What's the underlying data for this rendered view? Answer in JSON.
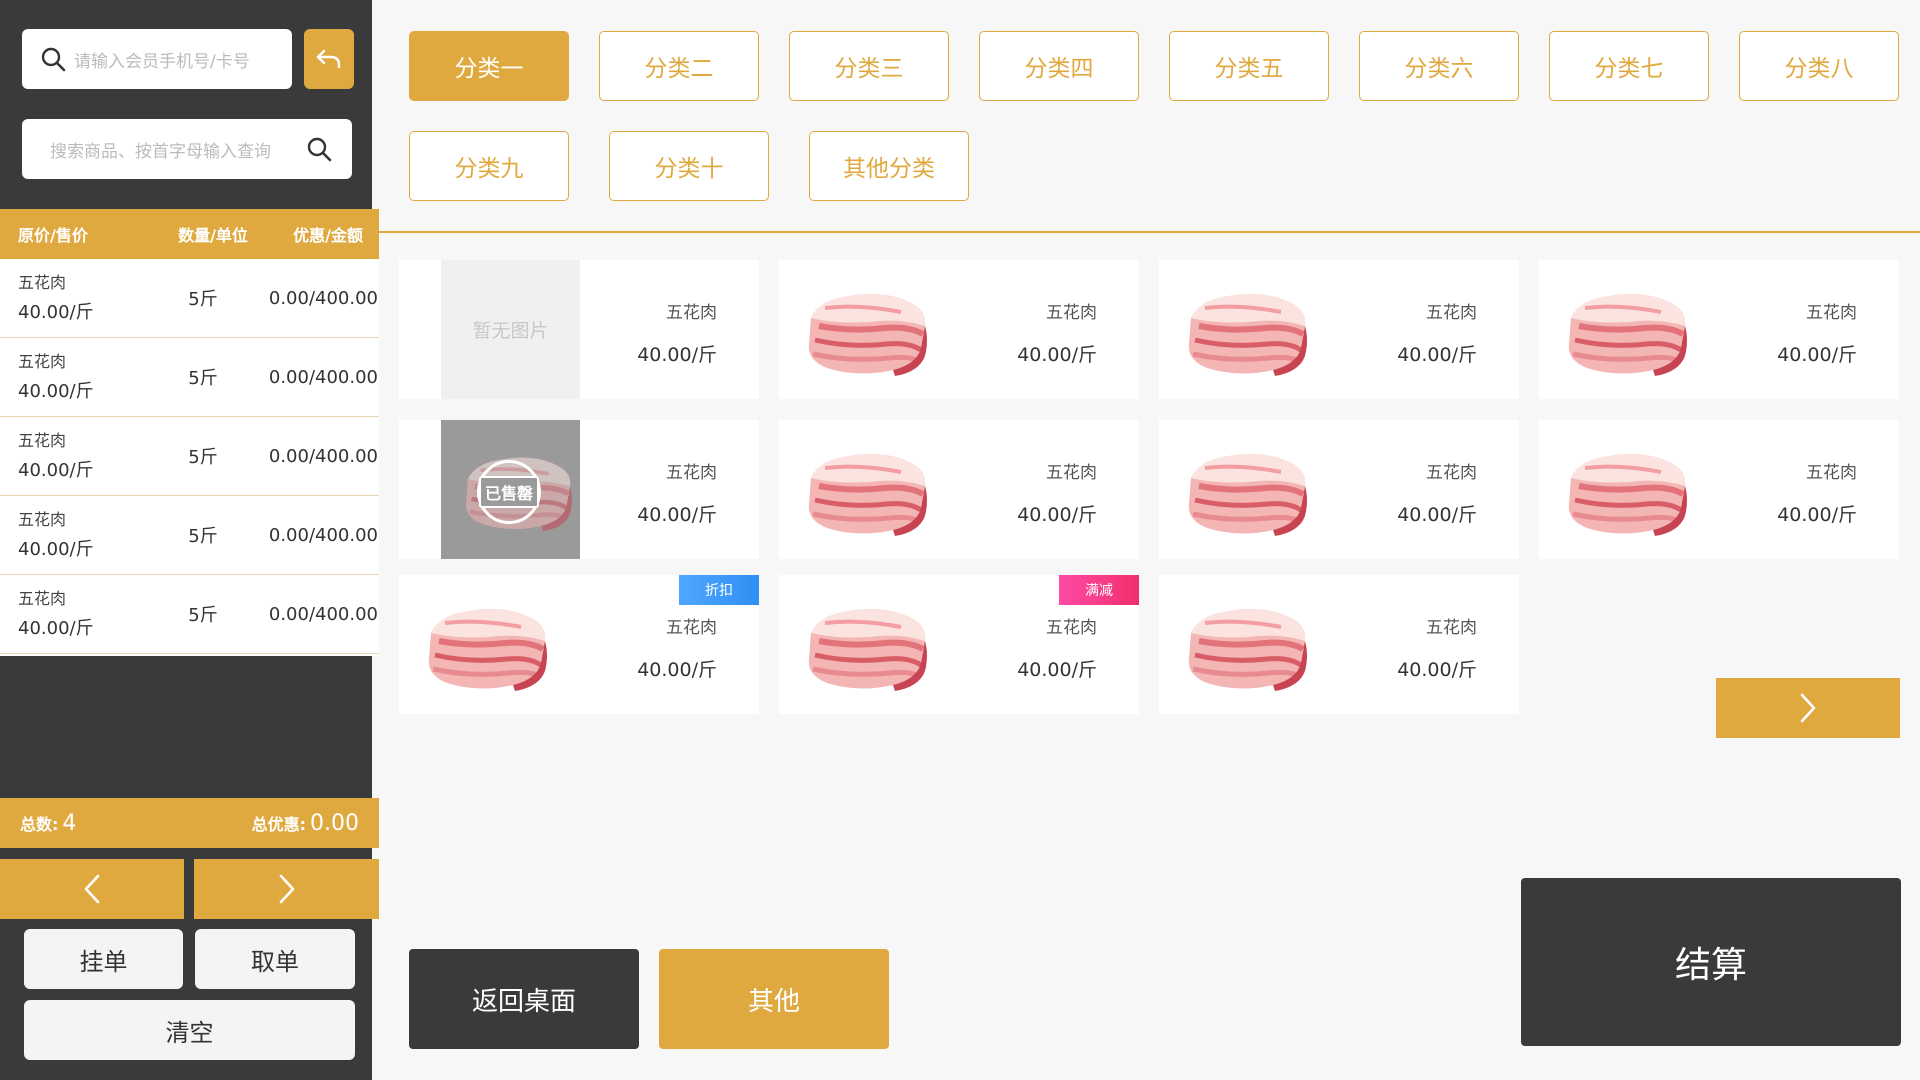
{
  "member_search": {
    "placeholder": "请输入会员手机号/卡号"
  },
  "product_search": {
    "placeholder": "搜索商品、按首字母输入查询"
  },
  "cart": {
    "headers": [
      "原价/售价",
      "数量/单位",
      "优惠/金额"
    ],
    "rows": [
      {
        "name": "五花肉",
        "price": "40.00/斤",
        "qty": "5斤",
        "amount": "0.00/400.00"
      },
      {
        "name": "五花肉",
        "price": "40.00/斤",
        "qty": "5斤",
        "amount": "0.00/400.00"
      },
      {
        "name": "五花肉",
        "price": "40.00/斤",
        "qty": "5斤",
        "amount": "0.00/400.00"
      },
      {
        "name": "五花肉",
        "price": "40.00/斤",
        "qty": "5斤",
        "amount": "0.00/400.00"
      },
      {
        "name": "五花肉",
        "price": "40.00/斤",
        "qty": "5斤",
        "amount": "0.00/400.00"
      }
    ]
  },
  "totals": {
    "count_label": "总数:",
    "count": "4",
    "discount_label": "总优惠:",
    "discount": "0.00"
  },
  "left_actions": {
    "hold": "挂单",
    "retrieve": "取单",
    "clear": "清空"
  },
  "categories": [
    "分类一",
    "分类二",
    "分类三",
    "分类四",
    "分类五",
    "分类六",
    "分类七",
    "分类八",
    "分类九",
    "分类十",
    "其他分类"
  ],
  "active_category": "分类一",
  "products": [
    {
      "name": "五花肉",
      "price": "40.00/斤",
      "image": "no-image",
      "no_image_text": "暂无图片"
    },
    {
      "name": "五花肉",
      "price": "40.00/斤",
      "image": "pork-belly"
    },
    {
      "name": "五花肉",
      "price": "40.00/斤",
      "image": "pork-belly"
    },
    {
      "name": "五花肉",
      "price": "40.00/斤",
      "image": "pork-belly"
    },
    {
      "name": "五花肉",
      "price": "40.00/斤",
      "image": "sold-out",
      "stamp_text": "已售罄"
    },
    {
      "name": "五花肉",
      "price": "40.00/斤",
      "image": "pork-belly"
    },
    {
      "name": "五花肉",
      "price": "40.00/斤",
      "image": "pork-belly"
    },
    {
      "name": "五花肉",
      "price": "40.00/斤",
      "image": "pork-belly"
    },
    {
      "name": "五花肉",
      "price": "40.00/斤",
      "image": "pork-belly",
      "badge": "折扣"
    },
    {
      "name": "五花肉",
      "price": "40.00/斤",
      "image": "pork-belly",
      "badge": "满减"
    },
    {
      "name": "五花肉",
      "price": "40.00/斤",
      "image": "pork-belly"
    }
  ],
  "bottom": {
    "back_desktop": "返回桌面",
    "other": "其他",
    "checkout": "结算"
  },
  "colors": {
    "accent": "#e0a93f",
    "dark": "#3a3a3a",
    "discount_badge": "#2f8ef2",
    "fullcut_badge": "#f02f6e"
  },
  "icons": [
    "search-icon",
    "return-arrow-icon",
    "chevron-left-icon",
    "chevron-right-icon"
  ]
}
